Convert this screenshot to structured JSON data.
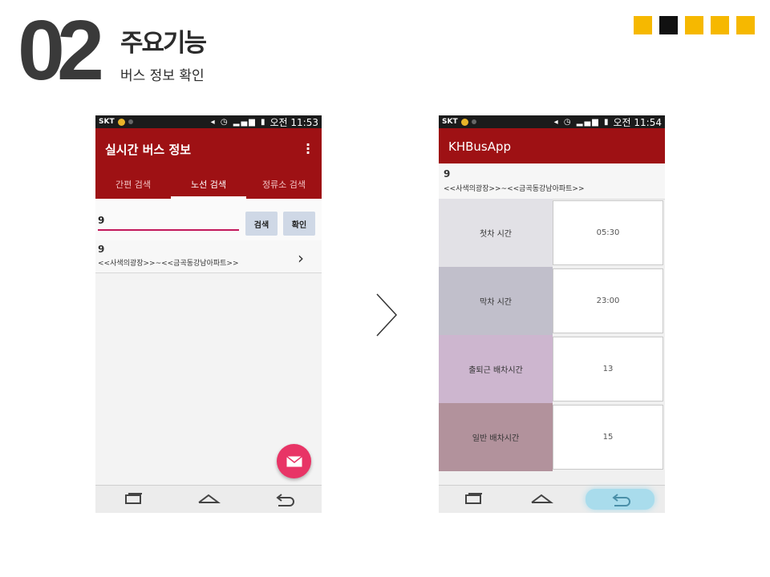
{
  "header": {
    "number": "02",
    "title": "주요기능",
    "subtitle": "버스 정보 확인",
    "squares": [
      "#f6b800",
      "#111111",
      "#f6b800",
      "#f6b800",
      "#f6b800"
    ]
  },
  "phone_left": {
    "status": {
      "carrier": "SKT",
      "time": "오전 11:53"
    },
    "app_title": "실시간 버스 정보",
    "tabs": [
      "간편 검색",
      "노선 검색",
      "정류소 검색"
    ],
    "active_tab": "노선 검색",
    "search_value": "9",
    "search_button": "검색",
    "confirm_button": "확인",
    "result": {
      "route": "9",
      "name": "<<사색의광장>>~<<금곡동강남아파트>>"
    },
    "chevron": "›",
    "accent_color": "#9e1114",
    "fab_color": "#e83466"
  },
  "phone_right": {
    "status": {
      "carrier": "SKT",
      "time": "오전 11:54"
    },
    "app_title": "KHBusApp",
    "route": "9",
    "route_name": "<<사색의광장>>~<<금곡동강남아파트>>",
    "rows": [
      {
        "label": "첫차 시간",
        "value": "05:30",
        "color": "#e2e1e6"
      },
      {
        "label": "막차 시간",
        "value": "23:00",
        "color": "#c1bfcb"
      },
      {
        "label": "출퇴근 배차시간",
        "value": "13",
        "color": "#cdb6cf"
      },
      {
        "label": "일반 배차시간",
        "value": "15",
        "color": "#b2929c"
      }
    ]
  }
}
